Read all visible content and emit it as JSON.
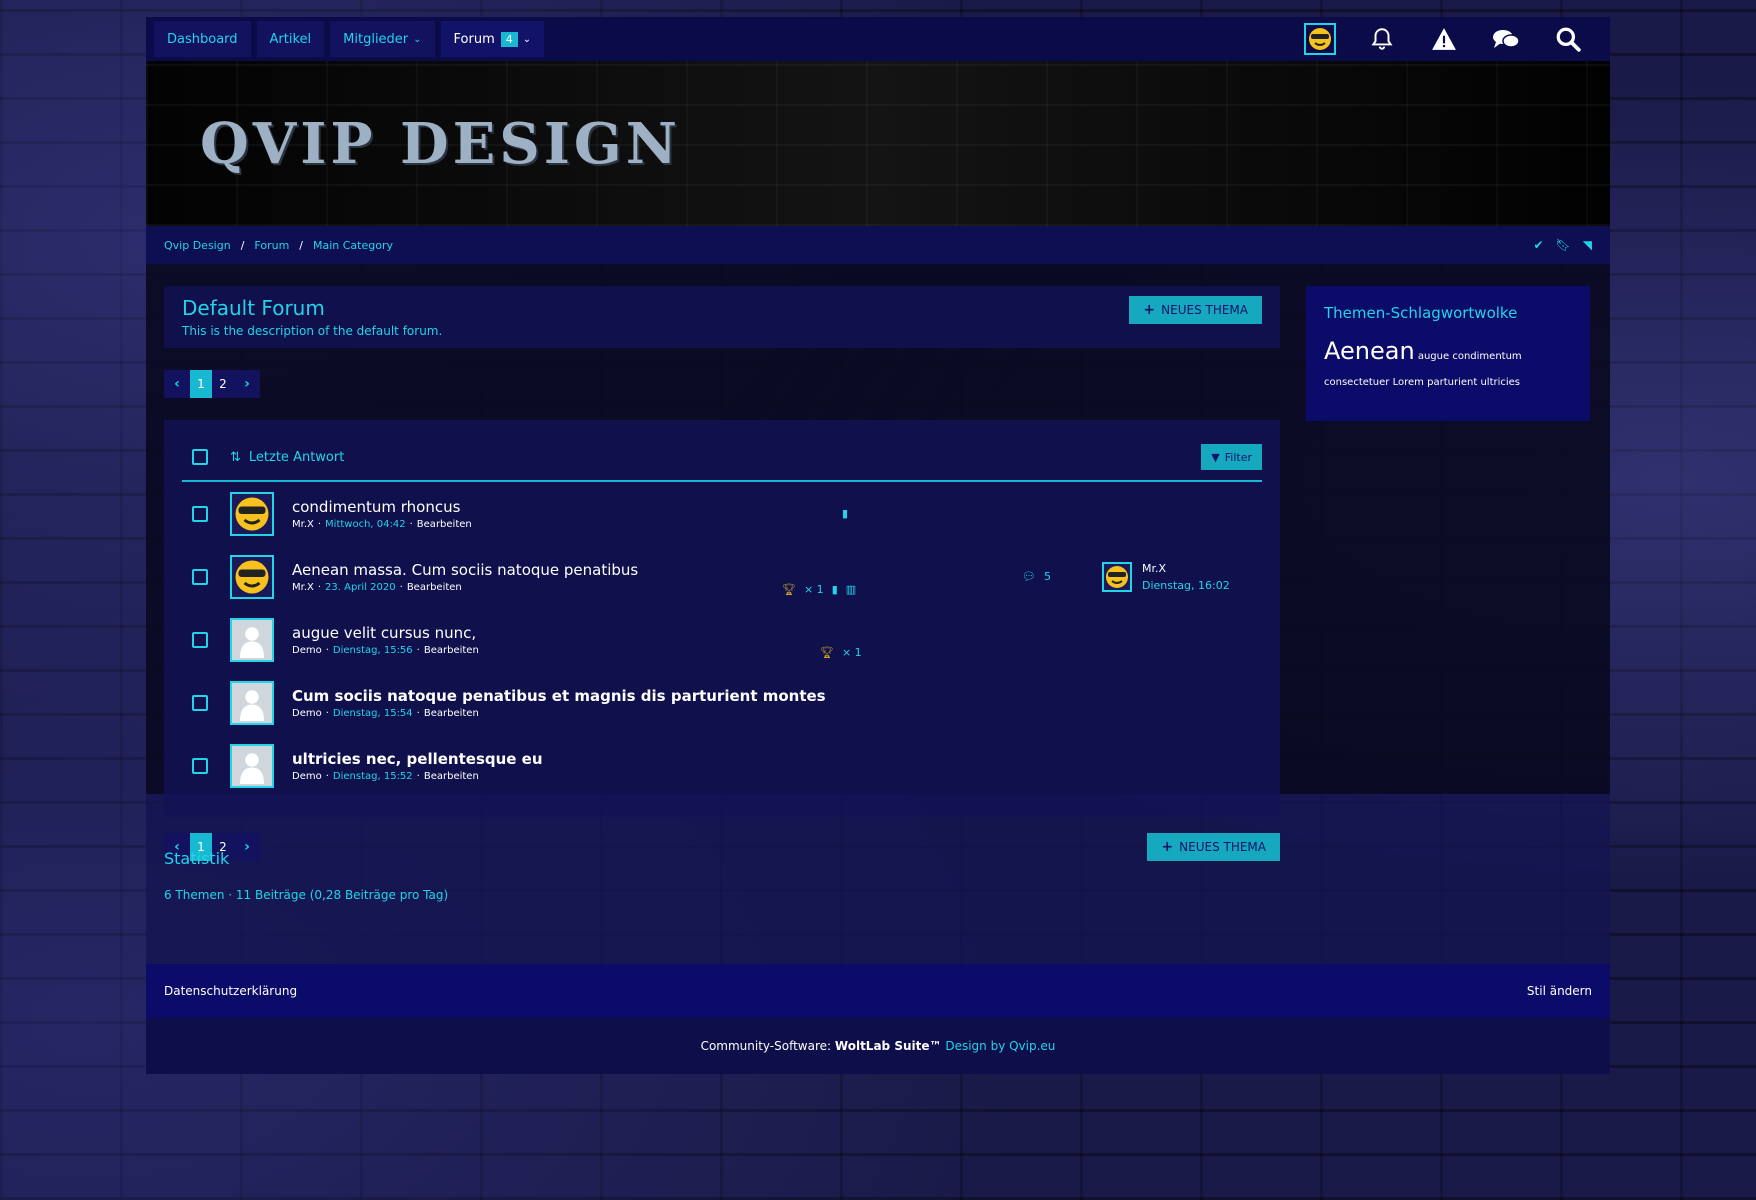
{
  "nav": {
    "items": [
      {
        "label": "Dashboard"
      },
      {
        "label": "Artikel"
      },
      {
        "label": "Mitglieder"
      },
      {
        "label": "Forum",
        "badge": "4"
      }
    ]
  },
  "header": {
    "logo_text": "QVIP DESIGN"
  },
  "breadcrumb": [
    "Qvip Design",
    "Forum",
    "Main Category"
  ],
  "forum": {
    "title": "Default Forum",
    "description": "This is the description of the default forum.",
    "new_thread_label": "NEUES THEMA"
  },
  "pagination": {
    "pages": [
      "1",
      "2"
    ],
    "current": "1"
  },
  "list": {
    "sort_label": "Letzte Antwort",
    "filter_label": "Filter",
    "threads": [
      {
        "title": "condimentum rhoncus",
        "author": "Mr.X",
        "date": "Mittwoch, 04:42",
        "edit": "Bearbeiten",
        "bold": false,
        "avatar": "smiley"
      },
      {
        "title": "Aenean massa. Cum sociis natoque penatibus",
        "author": "Mr.X",
        "date": "23. April 2020",
        "edit": "Bearbeiten",
        "bold": false,
        "avatar": "smiley",
        "trophy": "× 1",
        "replies": "5",
        "last_author": "Mr.X",
        "last_date": "Dienstag, 16:02"
      },
      {
        "title": "augue velit cursus nunc,",
        "author": "Demo",
        "date": "Dienstag, 15:56",
        "edit": "Bearbeiten",
        "bold": false,
        "avatar": "default",
        "trophy": "× 1"
      },
      {
        "title": "Cum sociis natoque penatibus et magnis dis parturient montes",
        "author": "Demo",
        "date": "Dienstag, 15:54",
        "edit": "Bearbeiten",
        "bold": true,
        "avatar": "default"
      },
      {
        "title": "ultricies nec, pellentesque eu",
        "author": "Demo",
        "date": "Dienstag, 15:52",
        "edit": "Bearbeiten",
        "bold": true,
        "avatar": "default"
      }
    ]
  },
  "sidebar": {
    "title": "Themen-Schlagwortwolke",
    "tags": {
      "big": "Aenean",
      "small": [
        "augue",
        "condimentum",
        "consectetuer",
        "Lorem",
        "parturient",
        "ultricies"
      ]
    }
  },
  "statistics": {
    "title": "Statistik",
    "text": "6 Themen · 11 Beiträge (0,28 Beiträge pro Tag)"
  },
  "footer": {
    "privacy": "Datenschutzerklärung",
    "style_change": "Stil ändern",
    "copyright_prefix": "Community-Software:",
    "copyright_brand": "WoltLab Suite™",
    "design_link": "Design by Qvip.eu"
  },
  "colors": {
    "accent": "#21d4e8",
    "button": "#15a8bf",
    "panel": "#121255"
  }
}
